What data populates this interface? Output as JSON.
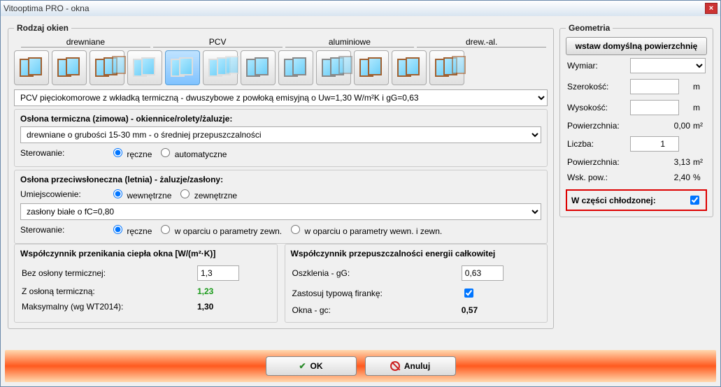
{
  "window": {
    "title": "Vitooptima PRO - okna"
  },
  "rodzaj": {
    "legend": "Rodzaj okien",
    "cats": [
      "drewniane",
      "PCV",
      "aluminiowe",
      "drew.-al."
    ],
    "dropdown": "PCV pięciokomorowe z wkładką termiczną - dwuszybowe z powłoką emisyjną o Uw=1,30 W/m²K i gG=0,63"
  },
  "zimowa": {
    "hdr": "Osłona termiczna (zimowa) - okiennice/rolety/żaluzje:",
    "dropdown": "drewniane o grubości 15-30 mm - o średniej przepuszczalności",
    "sterowanie_lbl": "Sterowanie:",
    "opt1": "ręczne",
    "opt2": "automatyczne"
  },
  "letnia": {
    "hdr": "Osłona przeciwsłoneczna (letnia) - żaluzje/zasłony:",
    "umiej_lbl": "Umiejscowienie:",
    "u1": "wewnętrzne",
    "u2": "zewnętrzne",
    "dropdown": "zasłony białe o fC=0,80",
    "sterowanie_lbl": "Sterowanie:",
    "s1": "ręczne",
    "s2": "w oparciu o parametry zewn.",
    "s3": "w oparciu o parametry wewn. i zewn."
  },
  "coefU": {
    "hdr": "Współczynnik przenikania ciepła okna [W/(m²·K)]",
    "bez_lbl": "Bez osłony termicznej:",
    "bez_val": "1,3",
    "z_lbl": "Z osłoną termiczną:",
    "z_val": "1,23",
    "max_lbl": "Maksymalny (wg WT2014):",
    "max_val": "1,30"
  },
  "coefG": {
    "hdr": "Współczynnik przepuszczalności energii całkowitej",
    "osz_lbl": "Oszklenia - gG:",
    "osz_val": "0,63",
    "fir_lbl": "Zastosuj typową firankę:",
    "okna_lbl": "Okna - gc:",
    "okna_val": "0,57"
  },
  "geo": {
    "legend": "Geometria",
    "btn": "wstaw domyślną powierzchnię",
    "wymiar_lbl": "Wymiar:",
    "szer_lbl": "Szerokość:",
    "wys_lbl": "Wysokość:",
    "pow1_lbl": "Powierzchnia:",
    "pow1_val": "0,00",
    "liczba_lbl": "Liczba:",
    "liczba_val": "1",
    "pow2_lbl": "Powierzchnia:",
    "pow2_val": "3,13",
    "wsk_lbl": "Wsk. pow.:",
    "wsk_val": "2,40",
    "m": "m",
    "m2": "m²",
    "pct": "%",
    "chlodz": "W części chłodzonej:"
  },
  "buttons": {
    "ok": "OK",
    "cancel": "Anuluj"
  }
}
